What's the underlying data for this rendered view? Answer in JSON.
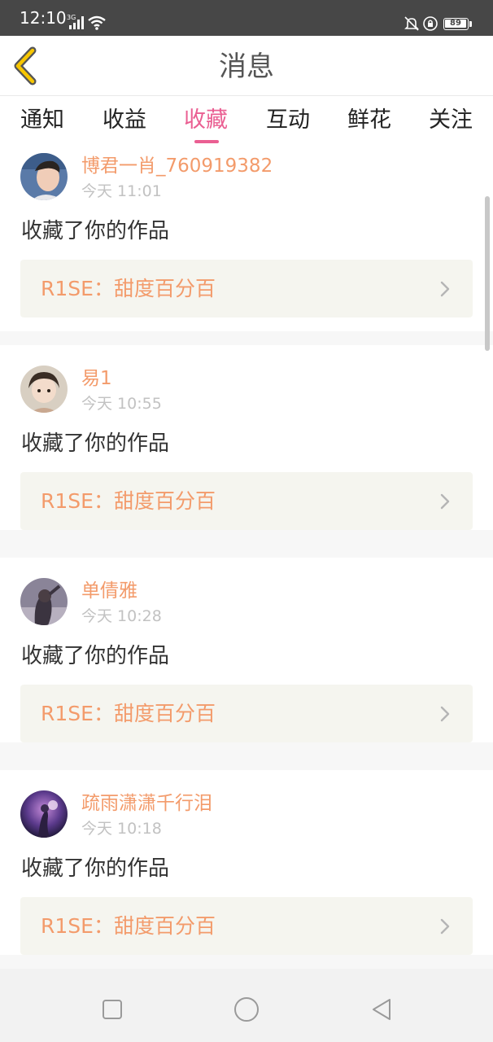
{
  "status": {
    "time": "12:10",
    "network": "3G",
    "battery": "89",
    "icons": [
      "signal-icon",
      "wifi-icon",
      "mute-icon",
      "lock-rotation-icon",
      "battery-icon"
    ]
  },
  "header": {
    "title": "消息",
    "back_icon": "chevron-left-icon"
  },
  "tabs": [
    {
      "label": "通知"
    },
    {
      "label": "收益"
    },
    {
      "label": "收藏"
    },
    {
      "label": "互动"
    },
    {
      "label": "鲜花"
    },
    {
      "label": "关注"
    }
  ],
  "active_tab": "收藏",
  "colors": {
    "accent_pink": "#ea5f92",
    "name_orange": "#f39b6b",
    "back_yellow": "#f7c600",
    "status_bar": "#474747"
  },
  "messages": [
    {
      "name": "博君一肖_760919382",
      "time": "今天 11:01",
      "action": "收藏了你的作品",
      "work": "R1SE：甜度百分百"
    },
    {
      "name": "易1",
      "time": "今天 10:55",
      "action": "收藏了你的作品",
      "work": "R1SE：甜度百分百"
    },
    {
      "name": "单倩雅",
      "time": "今天 10:28",
      "action": "收藏了你的作品",
      "work": "R1SE：甜度百分百"
    },
    {
      "name": "疏雨潇潇千行泪",
      "time": "今天 10:18",
      "action": "收藏了你的作品",
      "work": "R1SE：甜度百分百"
    }
  ],
  "nav": {
    "icons": [
      "square-recents-icon",
      "circle-home-icon",
      "triangle-back-icon"
    ]
  }
}
